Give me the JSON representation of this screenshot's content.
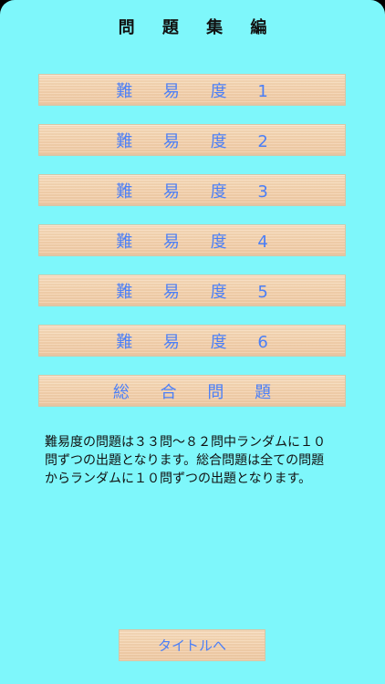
{
  "header": {
    "title": "問 題 集 編"
  },
  "menu": {
    "items": [
      {
        "label": "難 易 度 1"
      },
      {
        "label": "難 易 度 2"
      },
      {
        "label": "難 易 度 3"
      },
      {
        "label": "難 易 度 4"
      },
      {
        "label": "難 易 度 5"
      },
      {
        "label": "難 易 度 6"
      },
      {
        "label": "総 合 問 題"
      }
    ]
  },
  "description": {
    "lines": [
      "難易度の問題は３３問〜８２問中ランダムに１０",
      "問ずつの出題となります。総合問題は全ての問題",
      "からランダムに１０問ずつの出題となります。"
    ]
  },
  "footer": {
    "back_label": "タイトルへ"
  },
  "colors": {
    "background": "#7ef7fb",
    "button_text": "#4b7ff7",
    "wood": "#f4d3b0"
  }
}
